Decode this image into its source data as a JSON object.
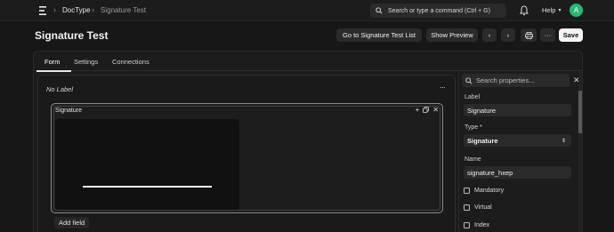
{
  "navbar": {
    "breadcrumbs": [
      "DocType",
      "Signature Test"
    ],
    "search_placeholder": "Search or type a command (Ctrl + G)",
    "help_label": "Help",
    "avatar_initial": "A"
  },
  "header": {
    "title": "Signature Test",
    "buttons": {
      "go_to_list": "Go to Signature Test List",
      "show_preview": "Show Preview",
      "more": "···",
      "save": "Save"
    }
  },
  "tabs": [
    "Form",
    "Settings",
    "Connections"
  ],
  "canvas": {
    "section_label": "No Label",
    "field": {
      "title": "Signature"
    },
    "add_field": "Add field"
  },
  "properties": {
    "search_placeholder": "Search properties...",
    "label_caption": "Label",
    "label_value": "Signature",
    "type_caption": "Type *",
    "type_value": "Signature",
    "name_caption": "Name",
    "name_value": "signature_hxep",
    "checkboxes": [
      "Mandatory",
      "Virtual",
      "Index"
    ]
  },
  "colors": {
    "background": "#171717",
    "avatar": "#2bb673",
    "save_button": "#f4f4f4"
  }
}
